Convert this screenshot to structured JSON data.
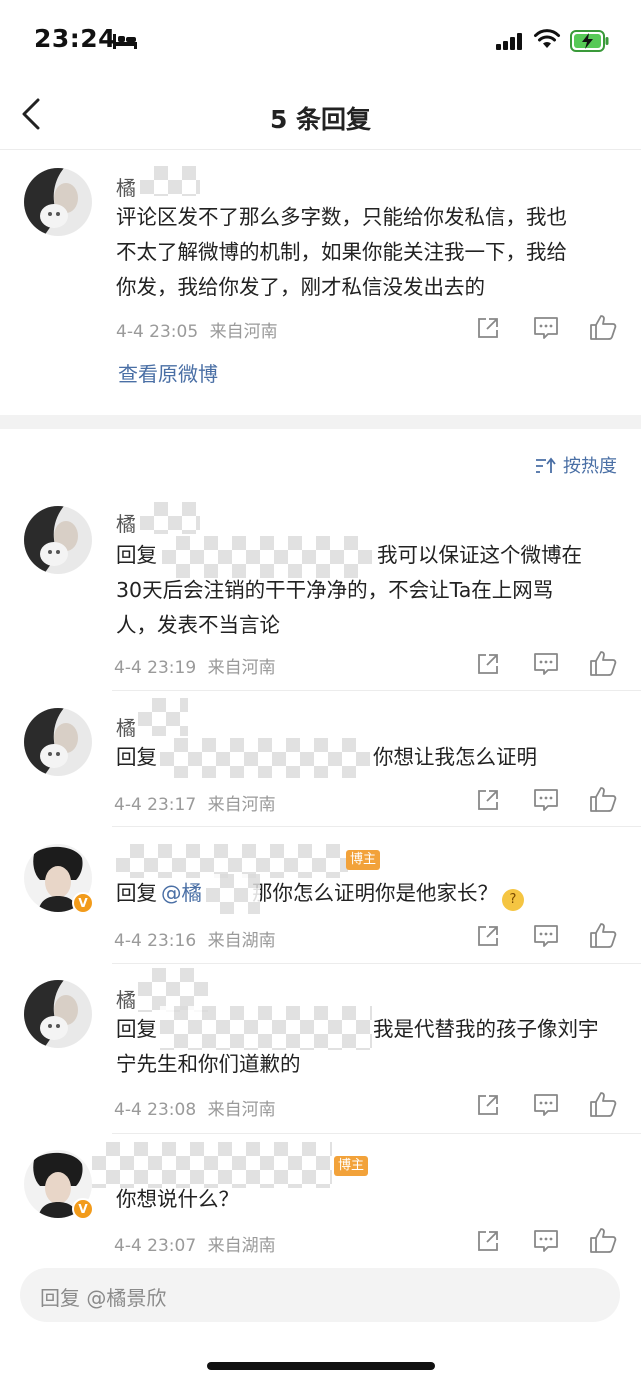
{
  "status": {
    "time": "23:24"
  },
  "nav": {
    "title": "5 条回复"
  },
  "original_comment": {
    "username": "橘",
    "text_lines": [
      "评论区发不了那么多字数，只能给你发私信，我也",
      "不太了解微博的机制，如果你能关注我一下，我给",
      "你发，我给你发了，刚才私信没发出去的"
    ],
    "time": "4-4 23:05",
    "location": "来自河南",
    "view_original_label": "查看原微博"
  },
  "sort": {
    "label": "按热度"
  },
  "replies": [
    {
      "username": "橘",
      "reply_prefix": "回复",
      "text_line1_tail": "我可以保证这个微博在",
      "text_lines_more": [
        "30天后会注销的干干净净的，不会让Ta在上网骂",
        "人，发表不当言论"
      ],
      "time": "4-4 23:19",
      "location": "来自河南"
    },
    {
      "username": "橘",
      "reply_prefix": "回复",
      "text_line1_tail": "你想让我怎么证明",
      "time": "4-4 23:17",
      "location": "来自河南"
    },
    {
      "blogger_tag": "博主",
      "reply_prefix": "回复",
      "mention": "@橘",
      "text_line1_tail": "那你怎么证明你是他家长？",
      "time": "4-4 23:16",
      "location": "来自湖南"
    },
    {
      "username": "橘",
      "reply_prefix": "回复",
      "text_line1_tail": "我是代替我的孩子像刘宇",
      "text_lines_more": [
        "宁先生和你们道歉的"
      ],
      "time": "4-4 23:08",
      "location": "来自河南"
    },
    {
      "blogger_tag": "博主",
      "text_line1_tail": "你想说什么？",
      "time": "4-4 23:07",
      "location": "来自湖南"
    }
  ],
  "reply_bar": {
    "placeholder": "回复 @橘景欣"
  },
  "colors": {
    "link": "#4a6fa5",
    "meta": "#9a9a9a",
    "badge": "#f29b1b"
  }
}
